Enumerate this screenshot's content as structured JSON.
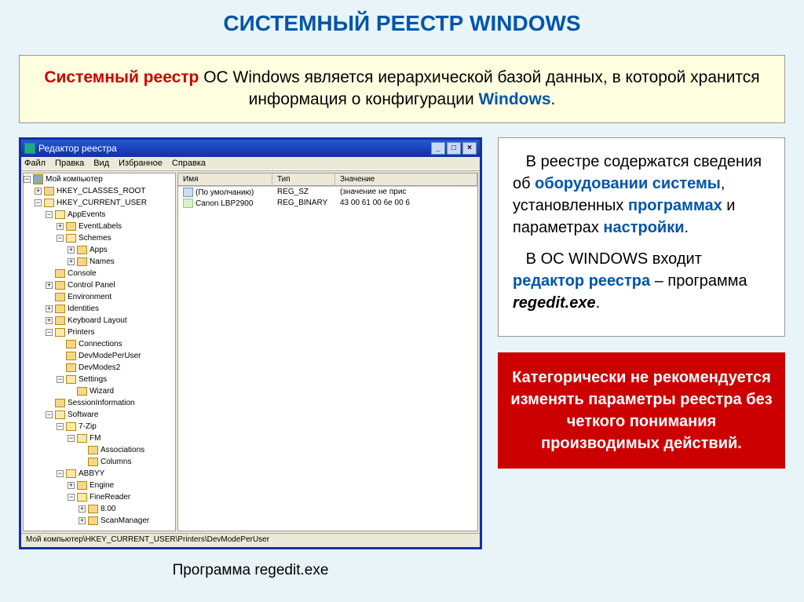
{
  "title": "СИСТЕМНЫЙ РЕЕСТР WINDOWS",
  "intro": {
    "p1a": "Системный реестр",
    "p1b": " ОС Windows является иерархической базой данных, в которой хранится информация о конфигурации ",
    "p1c": "Windows",
    "p1d": "."
  },
  "regedit": {
    "title": "Редактор реестра",
    "menu": [
      "Файл",
      "Правка",
      "Вид",
      "Избранное",
      "Справка"
    ],
    "root": "Мой компьютер",
    "tree": {
      "hkcr": "HKEY_CLASSES_ROOT",
      "hkcu": "HKEY_CURRENT_USER",
      "appevents": "AppEvents",
      "eventlabels": "EventLabels",
      "schemes": "Schemes",
      "apps": "Apps",
      "names": "Names",
      "console": "Console",
      "cpanel": "Control Panel",
      "env": "Environment",
      "ident": "Identities",
      "kbd": "Keyboard Layout",
      "printers": "Printers",
      "conn": "Connections",
      "dmpu": "DevModePerUser",
      "dm2": "DevModes2",
      "settings": "Settings",
      "wizard": "Wizard",
      "sessinfo": "SessionInformation",
      "software": "Software",
      "7zip": "7-Zip",
      "fm": "FM",
      "assoc": "Associations",
      "columns": "Columns",
      "abbyy": "ABBYY",
      "engine": "Engine",
      "fr": "FineReader",
      "v800": "8.00",
      "scanmgr": "ScanManager"
    },
    "columns": {
      "name": "Имя",
      "type": "Тип",
      "value": "Значение"
    },
    "rows": [
      {
        "name": "(По умолчанию)",
        "type": "REG_SZ",
        "value": "(значение не прис"
      },
      {
        "name": "Canon LBP2900",
        "type": "REG_BINARY",
        "value": "43 00 61 00 6e 00 6"
      }
    ],
    "status": "Мой компьютер\\HKEY_CURRENT_USER\\Printers\\DevModePerUser"
  },
  "caption": "Программа regedit.exe",
  "info1": {
    "p1a": "В реестре содержатся сведения об ",
    "p1b": "оборудовании системы",
    "p1c": ", установленных ",
    "p1d": "программах",
    "p1e": " и параметрах ",
    "p1f": "настройки",
    "p1g": ".",
    "p2a": "В ОС WINDOWS входит ",
    "p2b": "редактор реестра",
    "p2c": " – программа ",
    "p2d": "regedit.exe",
    "p2e": "."
  },
  "warn": "Категорически не рекомендуется изменять параметры реестра без четкого понимания производимых действий."
}
